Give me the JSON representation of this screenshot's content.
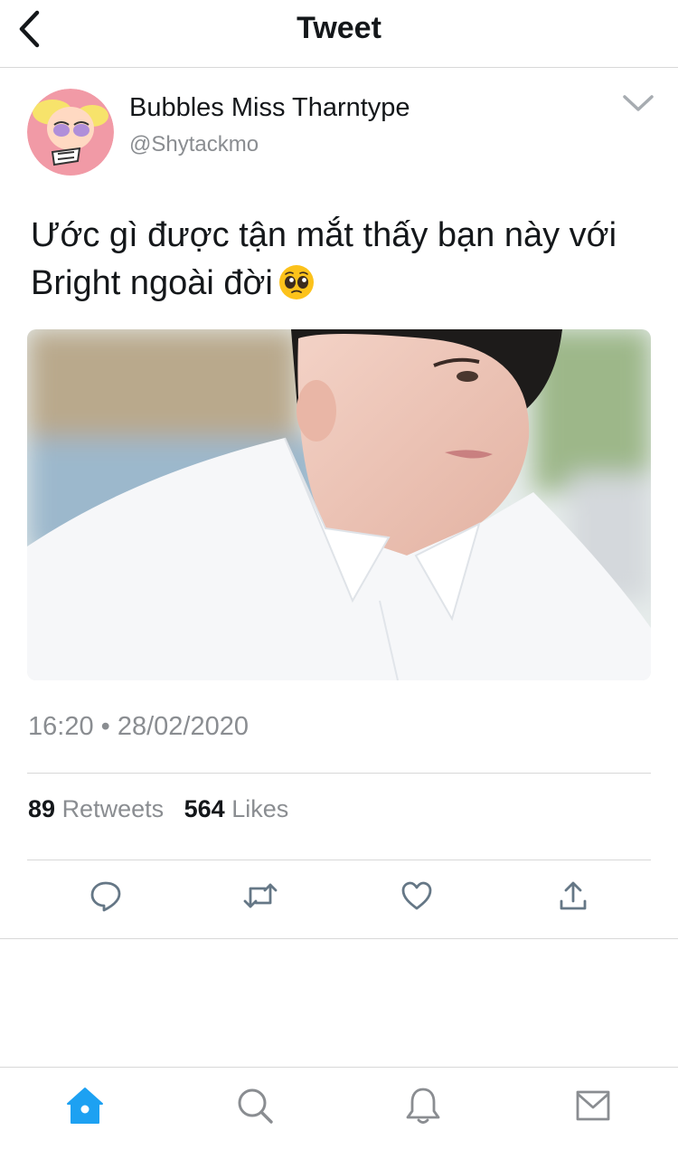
{
  "header": {
    "title": "Tweet",
    "back_icon": "chevron-left-icon"
  },
  "tweet": {
    "author_name": "Bubbles Miss Tharntype",
    "author_handle": "@Shytackmo",
    "text": "Ước gì được tận mắt thấy bạn này với Bright ngoài đời",
    "emoji": "pleading-face-emoji",
    "timestamp": "16:20 • 28/02/2020",
    "retweets_count": "89",
    "retweets_label": "Retweets",
    "likes_count": "564",
    "likes_label": "Likes"
  },
  "actions": [
    "reply-icon",
    "retweet-icon",
    "like-icon",
    "share-icon"
  ],
  "tabbar": [
    "home-icon",
    "search-icon",
    "notifications-icon",
    "messages-icon"
  ],
  "colors": {
    "accent": "#1da1f2",
    "secondary_text": "#8a8d91",
    "divider": "#d8d8d8",
    "avatar_bg": "#f19aa6"
  }
}
